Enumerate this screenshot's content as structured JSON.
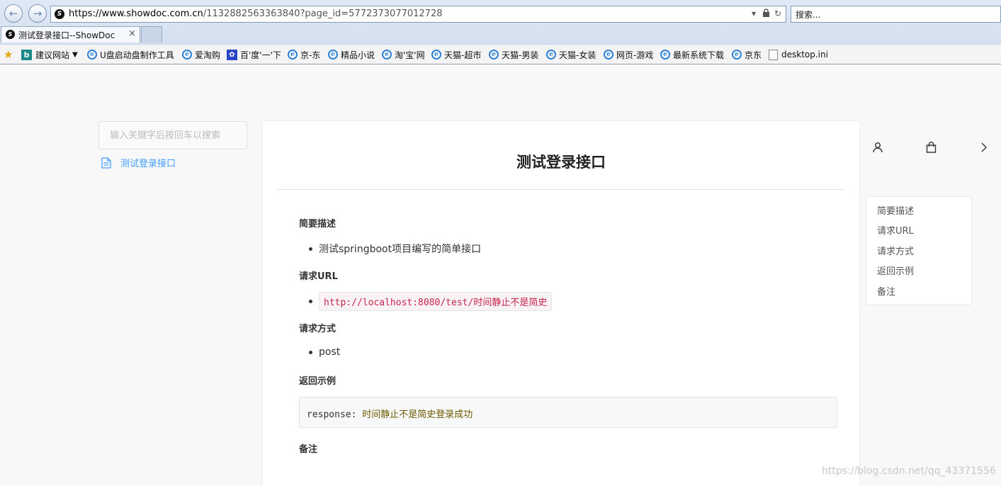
{
  "browser": {
    "address_url_host": "https://www.showdoc.com.cn",
    "address_url_rest": "/1132882563363840?page_id=5772373077012728",
    "search_placeholder": "搜索...",
    "tab_title": "测试登录接口--ShowDoc",
    "tab_close": "×",
    "back_glyph": "←",
    "forward_glyph": "→",
    "favorites": [
      {
        "label": "建议网站",
        "icon": "bing-icon"
      },
      {
        "label": "U盘启动盘制作工具",
        "icon": "ie-icon"
      },
      {
        "label": "爱淘购",
        "icon": "ie-icon"
      },
      {
        "label": "百'度'一'下",
        "icon": "baidu-paw-icon"
      },
      {
        "label": "京-东",
        "icon": "ie-icon"
      },
      {
        "label": "精品小说",
        "icon": "ie-icon"
      },
      {
        "label": "淘'宝'网",
        "icon": "ie-icon"
      },
      {
        "label": "天猫-超市",
        "icon": "ie-icon"
      },
      {
        "label": "天猫-男装",
        "icon": "ie-icon"
      },
      {
        "label": "天猫-女装",
        "icon": "ie-icon"
      },
      {
        "label": "网页-游戏",
        "icon": "ie-icon"
      },
      {
        "label": "最新系统下载",
        "icon": "ie-icon"
      },
      {
        "label": "京东",
        "icon": "ie-icon"
      },
      {
        "label": "desktop.ini",
        "icon": "file-icon"
      }
    ]
  },
  "sidebar": {
    "search_placeholder": "输入关键字后按回车以搜索",
    "items": [
      {
        "label": "测试登录接口"
      }
    ]
  },
  "doc": {
    "title": "测试登录接口",
    "sections": [
      {
        "heading": "简要描述",
        "bullet": "测试springboot项目编写的简单接口"
      },
      {
        "heading": "请求URL",
        "code_inline": "http://localhost:8080/test/时间静止不是简史"
      },
      {
        "heading": "请求方式",
        "bullet": "post"
      },
      {
        "heading": "返回示例",
        "code_key": "response:",
        "code_value": "时间静止不是简史登录成功"
      },
      {
        "heading": "备注"
      }
    ]
  },
  "toc": {
    "items": [
      "简要描述",
      "请求URL",
      "请求方式",
      "返回示例",
      "备注"
    ]
  },
  "watermark": "https://blog.csdn.net/qq_43371556",
  "colors": {
    "link_blue": "#409eff",
    "code_red": "#c7254e"
  }
}
